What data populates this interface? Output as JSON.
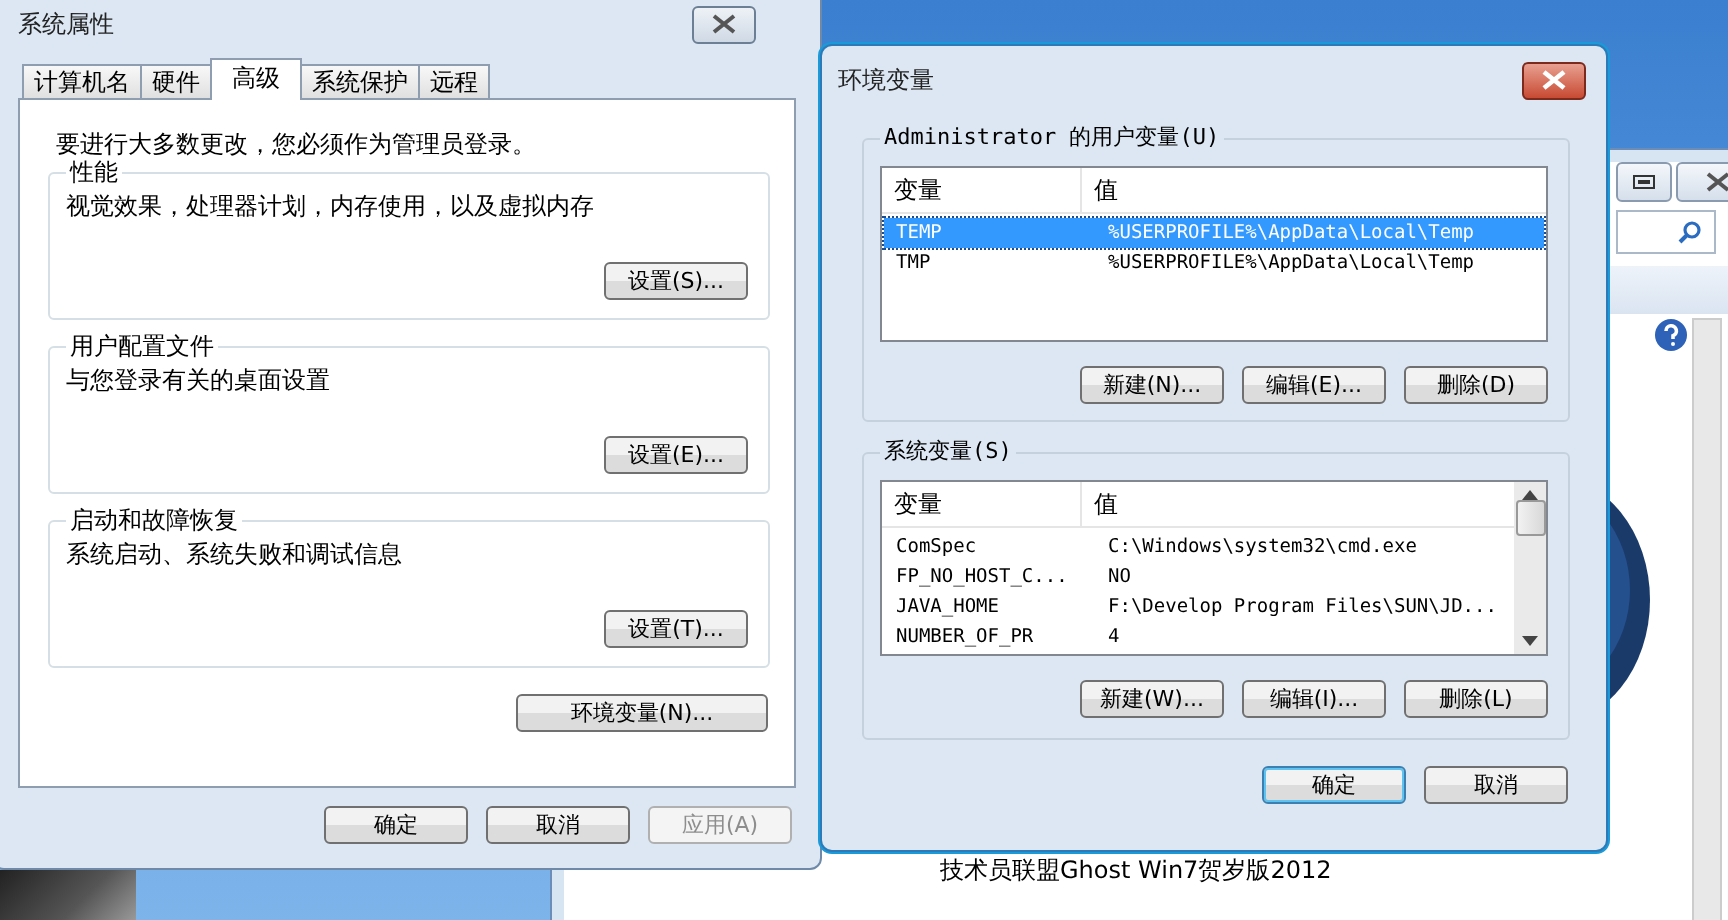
{
  "background_window": {
    "caption": "技术员联盟Ghost Win7贺岁版2012"
  },
  "system_properties": {
    "title": "系统属性",
    "tabs": [
      {
        "label": "计算机名",
        "selected": false
      },
      {
        "label": "硬件",
        "selected": false
      },
      {
        "label": "高级",
        "selected": true
      },
      {
        "label": "系统保护",
        "selected": false
      },
      {
        "label": "远程",
        "selected": false
      }
    ],
    "notice": "要进行大多数更改，您必须作为管理员登录。",
    "groups": [
      {
        "title": "性能",
        "description": "视觉效果，处理器计划，内存使用，以及虚拟内存",
        "button": "设置(S)..."
      },
      {
        "title": "用户配置文件",
        "description": "与您登录有关的桌面设置",
        "button": "设置(E)..."
      },
      {
        "title": "启动和故障恢复",
        "description": "系统启动、系统失败和调试信息",
        "button": "设置(T)..."
      }
    ],
    "env_button": "环境变量(N)...",
    "buttons": [
      {
        "label": "确定",
        "disabled": false
      },
      {
        "label": "取消",
        "disabled": false
      },
      {
        "label": "应用(A)",
        "disabled": true
      }
    ]
  },
  "env_dialog": {
    "title": "环境变量",
    "sections": [
      {
        "title": "Administrator 的用户变量(U)",
        "columns": [
          "变量",
          "值"
        ],
        "scrollbar": false,
        "rows": [
          {
            "name": "TEMP",
            "value": "%USERPROFILE%\\AppData\\Local\\Temp",
            "selected": true
          },
          {
            "name": "TMP",
            "value": "%USERPROFILE%\\AppData\\Local\\Temp",
            "selected": false
          }
        ],
        "buttons": [
          "新建(N)...",
          "编辑(E)...",
          "删除(D)"
        ]
      },
      {
        "title": "系统变量(S)",
        "columns": [
          "变量",
          "值"
        ],
        "scrollbar": true,
        "rows": [
          {
            "name": "ComSpec",
            "value": "C:\\Windows\\system32\\cmd.exe",
            "selected": false
          },
          {
            "name": "FP_NO_HOST_C...",
            "value": "NO",
            "selected": false
          },
          {
            "name": "JAVA_HOME",
            "value": "F:\\Develop Program Files\\SUN\\JD...",
            "selected": false
          },
          {
            "name": "NUMBER_OF_PR",
            "value": "4",
            "selected": false
          }
        ],
        "buttons": [
          "新建(W)...",
          "编辑(I)...",
          "删除(L)"
        ]
      }
    ],
    "buttons": [
      {
        "label": "确定",
        "default": true
      },
      {
        "label": "取消",
        "default": false
      }
    ]
  }
}
